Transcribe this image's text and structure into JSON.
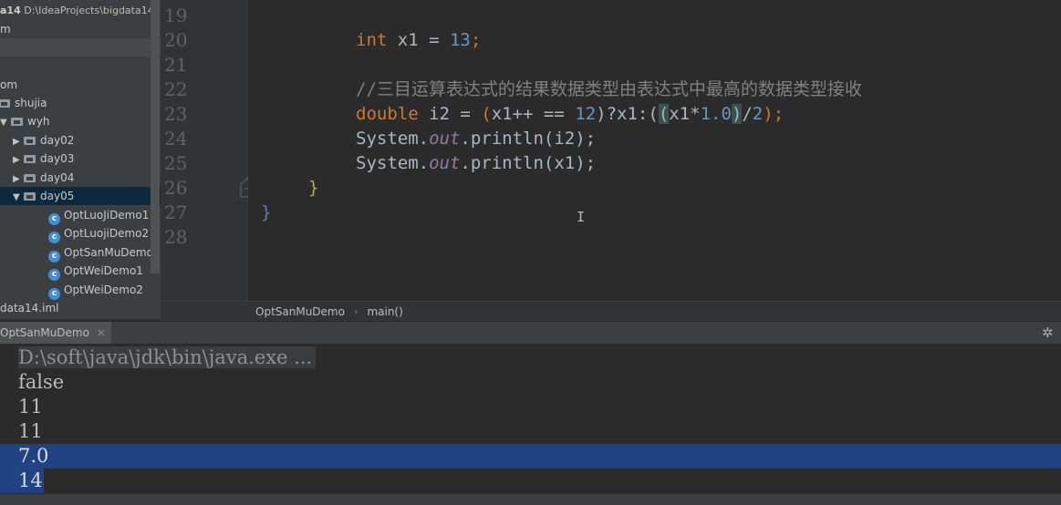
{
  "project": {
    "title_short": "a14",
    "title_path": "D:\\IdeaProjects\\bigdata14",
    "items": [
      {
        "label": "m"
      },
      {
        "label": "om"
      },
      {
        "label": "shujia"
      },
      {
        "label": "wyh"
      },
      {
        "label": "day02"
      },
      {
        "label": "day03"
      },
      {
        "label": "day04"
      },
      {
        "label": "day05"
      },
      {
        "label": "OptLuoJiDemo1"
      },
      {
        "label": "OptLuojiDemo2"
      },
      {
        "label": "OptSanMuDemo"
      },
      {
        "label": "OptWeiDemo1"
      },
      {
        "label": "OptWeiDemo2"
      },
      {
        "label": "data14.iml"
      }
    ]
  },
  "editor": {
    "line_numbers": [
      "19",
      "20",
      "21",
      "22",
      "23",
      "24",
      "25",
      "26",
      "27",
      "28"
    ],
    "line20": {
      "kw": "int",
      "rest": " x1 = ",
      "num": "13",
      "end": ";"
    },
    "comment": "//三目运算表达式的结果数据类型由表达式中最高的数据类型接收",
    "line23": {
      "kw": "double",
      "a": " i2 = ",
      "p1": "(",
      "b": "x1++ == ",
      "n1": "12",
      "c": ")?x1:(",
      "p2": "(",
      "d": "x1*",
      "n2": "1.0",
      "p3": ")",
      "e": "/",
      "n3": "2",
      "f": ");"
    },
    "line24": {
      "a": "System.",
      "out": "out",
      "b": ".println(i2);"
    },
    "line25": {
      "a": "System.",
      "out": "out",
      "b": ".println(x1);"
    },
    "brace_inner": "}",
    "brace_outer": "}",
    "cursor": "I"
  },
  "breadcrumb": {
    "class": "OptSanMuDemo",
    "sep": "›",
    "method": "main()"
  },
  "run": {
    "tab_label": "OptSanMuDemo",
    "tab_close": "×",
    "settings_glyph": "✲"
  },
  "console": {
    "command": "D:\\soft\\java\\jdk\\bin\\java.exe ...",
    "lines": [
      "false",
      "11",
      "11",
      "7.0",
      "14"
    ]
  },
  "colors": {
    "selection": "#214283",
    "editor_bg": "#2b2b2b",
    "keyword": "#cc7832",
    "number": "#6897bb"
  }
}
